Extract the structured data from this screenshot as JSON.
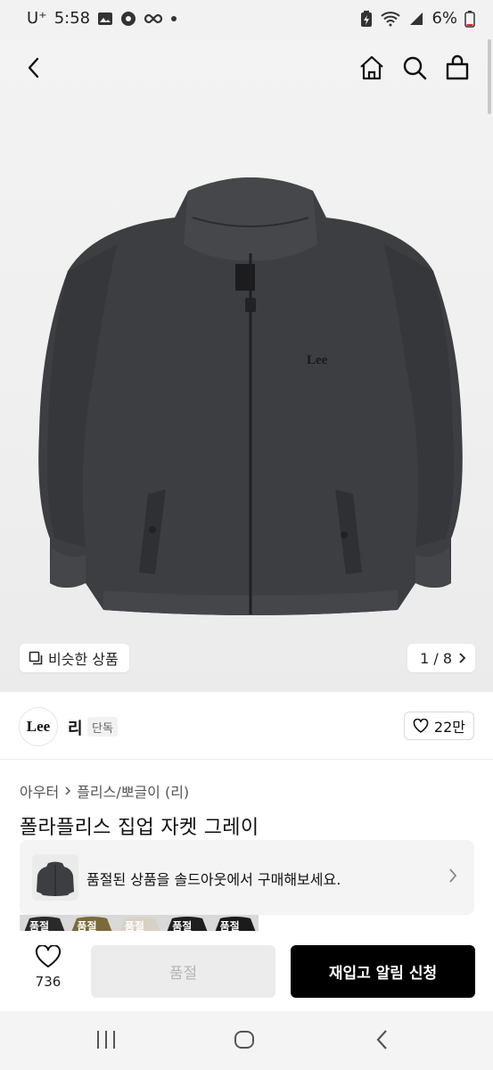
{
  "status_bar": {
    "carrier": "U⁺",
    "time": "5:58",
    "battery": "6%",
    "icons": [
      "gallery-icon",
      "soccer-icon",
      "infinity-icon",
      "dot-icon",
      "battery-saver-icon",
      "wifi-icon",
      "signal-icon",
      "battery-icon"
    ]
  },
  "nav": {
    "icons": [
      "back-icon",
      "home-icon",
      "search-icon",
      "cart-icon"
    ]
  },
  "hero": {
    "similar_label": "비슷한 상품",
    "pager": "1 / 8",
    "jacket_logo": "Lee"
  },
  "brand": {
    "logo_text": "Lee",
    "name": "리",
    "badge": "단독",
    "likes": "22만"
  },
  "breadcrumb": {
    "level1": "아우터",
    "level2": "플리스/뽀글이 (리)"
  },
  "product": {
    "title": "폴라플리스 집업 자켓 그레이"
  },
  "soldout_banner": {
    "text": "품절된 상품을 솔드아웃에서 구매해보세요."
  },
  "swatches": [
    {
      "label": "품절",
      "color": "#2a2a2a"
    },
    {
      "label": "품절",
      "color": "#7a6a3a"
    },
    {
      "label": "품절",
      "color": "#d8d2c4"
    },
    {
      "label": "품절",
      "color": "#1e1e1e"
    },
    {
      "label": "품절",
      "color": "#1a1a1a"
    }
  ],
  "bottom_bar": {
    "wish_count": "736",
    "soldout_label": "품절",
    "restock_label": "재입고 알림 신청"
  },
  "colors": {
    "jacket": "#3d3e42",
    "cta": "#000000",
    "disabled": "#ececec"
  }
}
